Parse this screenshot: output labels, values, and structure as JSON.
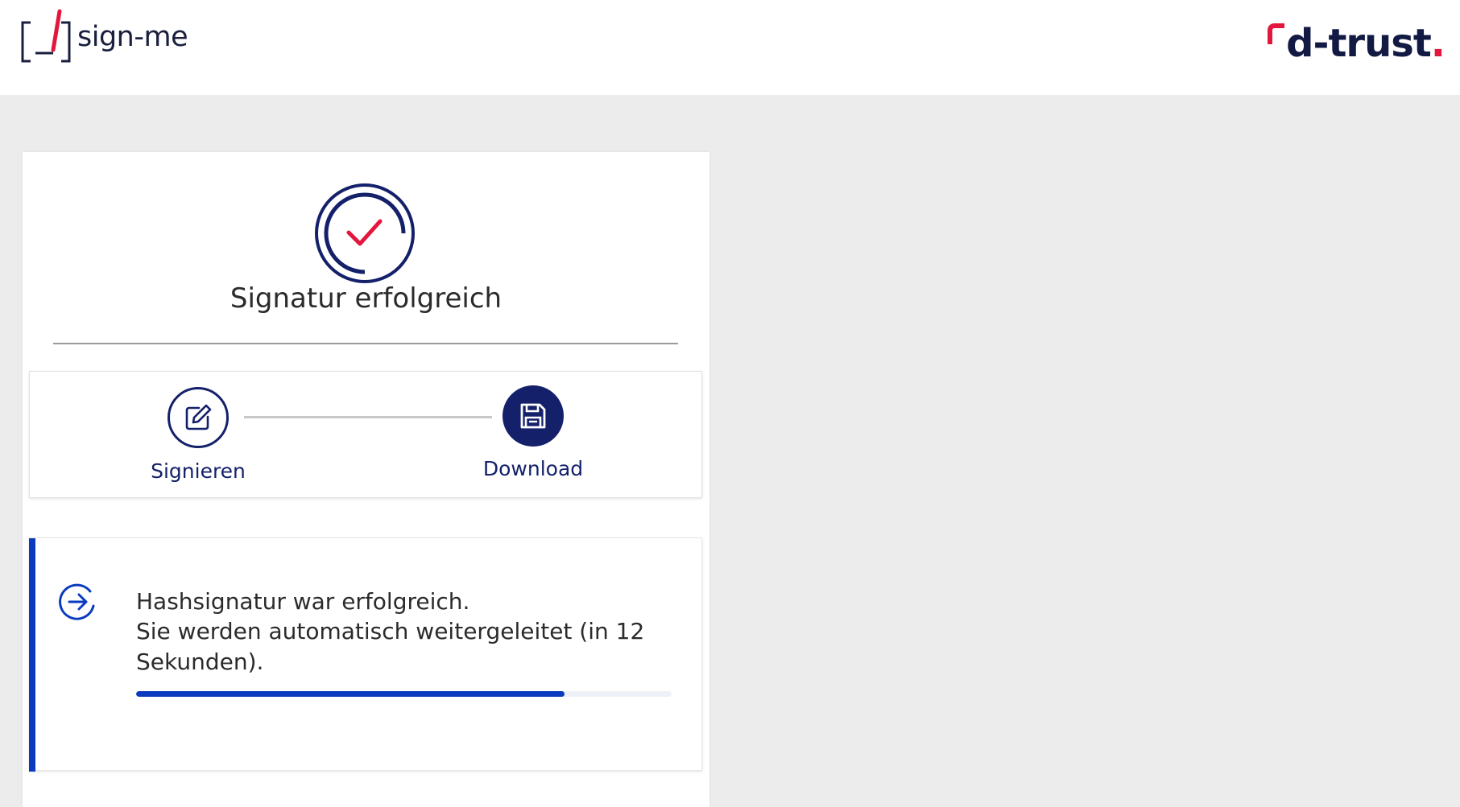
{
  "header": {
    "left_logo_text": "sign-me",
    "right_logo_text": "d-trust",
    "right_logo_dot": "."
  },
  "card": {
    "title": "Signatur erfolgreich",
    "status_icon": "check-circle-icon"
  },
  "stepper": {
    "steps": [
      {
        "label": "Signieren",
        "icon": "edit-icon"
      },
      {
        "label": "Download",
        "icon": "save-icon"
      }
    ]
  },
  "notice": {
    "line1": "Hashsignatur war erfolgreich.",
    "line2": "Sie werden automatisch weitergeleitet (in 12",
    "line3": "Sekunden).",
    "icon": "arrow-right-circle-icon",
    "progress": 0.8
  },
  "colors": {
    "brand_navy": "#14216a",
    "accent_red": "#e3173e",
    "accent_blue": "#0a3bbf",
    "background": "#ececec"
  }
}
